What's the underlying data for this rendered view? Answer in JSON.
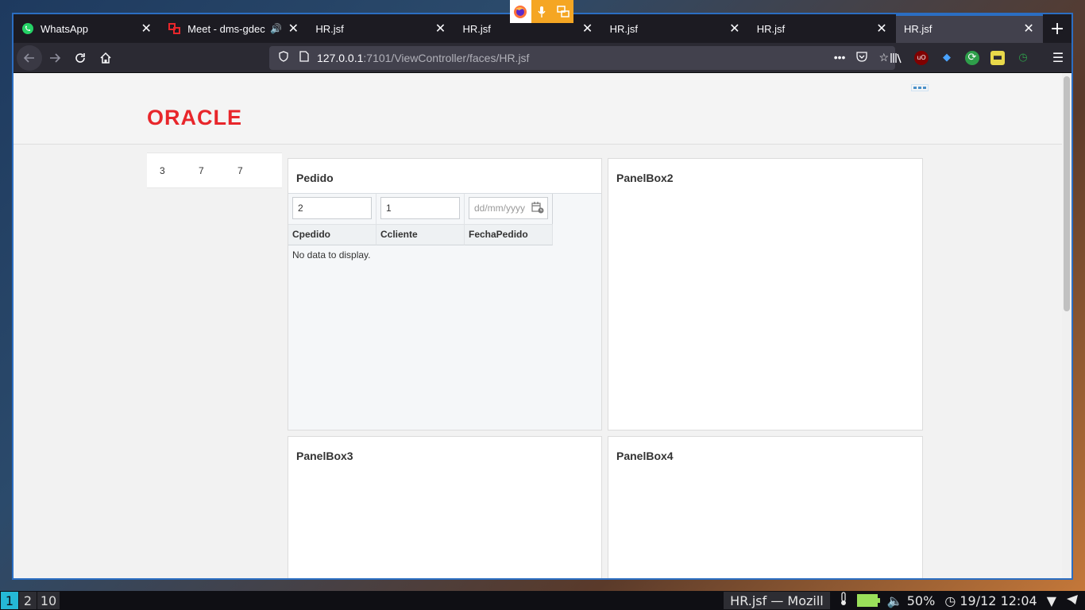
{
  "sharing_indicator": {
    "browser_icon": "firefox-icon",
    "mic_icon": "microphone-icon",
    "screen_icon": "screen-share-icon"
  },
  "tabs": [
    {
      "title": "WhatsApp",
      "icon": "whatsapp-icon"
    },
    {
      "title": "Meet - dms-gdec",
      "icon": "meet-icon",
      "audio": "🔊"
    },
    {
      "title": "HR.jsf"
    },
    {
      "title": "HR.jsf"
    },
    {
      "title": "HR.jsf"
    },
    {
      "title": "HR.jsf"
    },
    {
      "title": "HR.jsf"
    }
  ],
  "newtab_label": "+",
  "close_glyph": "✕",
  "url": {
    "host": "127.0.0.1",
    "path": ":7101/ViewController/faces/HR.jsf"
  },
  "page": {
    "logo_text": "ORACLE",
    "side_numbers": [
      "3",
      "7",
      "7"
    ],
    "panels": {
      "p1": {
        "title": "Pedido",
        "filters": [
          "2",
          "1"
        ],
        "date_placeholder": "dd/mm/yyyy",
        "columns": [
          "Cpedido",
          "Ccliente",
          "FechaPedido"
        ],
        "empty_text": "No data to display."
      },
      "p2": {
        "title": "PanelBox2"
      },
      "p3": {
        "title": "PanelBox3"
      },
      "p4": {
        "title": "PanelBox4"
      }
    }
  },
  "system_panel": {
    "workspaces": [
      "1",
      "2",
      "10"
    ],
    "active_window": "HR.jsf — Mozill",
    "volume": "50%",
    "clock": "19/12 12:04"
  },
  "colors": {
    "oracle_red": "#e8262b",
    "accent": "#2b6ec2",
    "active_workspace": "#25b8d6",
    "battery": "#9ae05a"
  }
}
